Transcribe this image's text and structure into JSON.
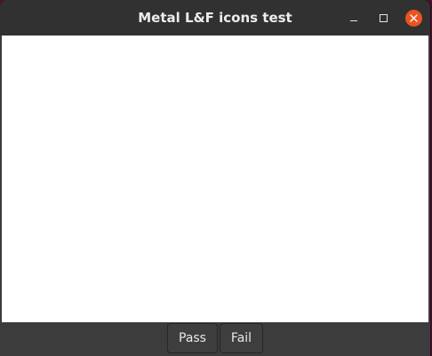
{
  "window": {
    "title": "Metal L&F icons test",
    "controls": {
      "minimize_icon": "minimize-icon",
      "maximize_icon": "maximize-icon",
      "close_icon": "close-icon"
    },
    "accent_color": "#e95420"
  },
  "footer": {
    "pass_label": "Pass",
    "fail_label": "Fail"
  }
}
